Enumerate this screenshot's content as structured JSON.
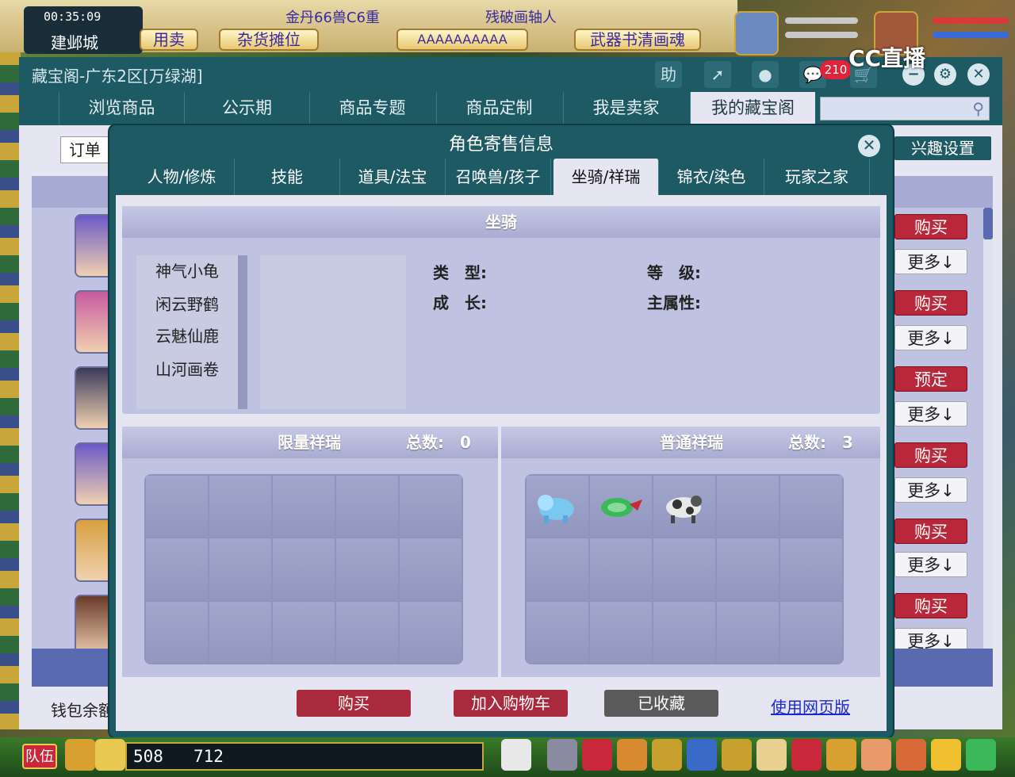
{
  "hud": {
    "clock": "00:35:09",
    "city": "建邺城",
    "buttons": [
      "用卖",
      "杂货摊位",
      "AAAAAAAAAA",
      "武器书清画魂"
    ],
    "top_texts": [
      "金丹66兽C6重",
      "残破画轴人"
    ],
    "team_label": "队伍",
    "coord_x": "508",
    "coord_y": "712",
    "watermark": "CC直播"
  },
  "main_window": {
    "title": "藏宝阁-广东2区[万绿湖]",
    "help_label": "助",
    "notification_count": "210",
    "tabs": [
      "浏览商品",
      "公示期",
      "商品专题",
      "商品定制",
      "我是卖家",
      "我的藏宝阁"
    ],
    "active_tab": 5,
    "order_select": "订单",
    "interest_button": "兴趣设置",
    "wallet_label": "钱包余额",
    "rows": [
      {
        "action": "购买",
        "more": "更多↓",
        "avatar_color": "#6a5ac8"
      },
      {
        "action": "购买",
        "more": "更多↓",
        "avatar_color": "#c85aa0"
      },
      {
        "action": "预定",
        "more": "更多↓",
        "avatar_color": "#3a3a5a"
      },
      {
        "action": "购买",
        "more": "更多↓",
        "avatar_color": "#6a5ac8"
      },
      {
        "action": "购买",
        "more": "更多↓",
        "avatar_color": "#d8a040"
      },
      {
        "action": "购买",
        "more": "更多↓",
        "avatar_color": "#6a3a2a"
      }
    ]
  },
  "dialog": {
    "title": "角色寄售信息",
    "tabs": [
      "人物/修炼",
      "技能",
      "道具/法宝",
      "召唤兽/孩子",
      "坐骑/祥瑞",
      "锦衣/染色",
      "玩家之家"
    ],
    "active_tab": 4,
    "mount_section": {
      "title": "坐骑",
      "mounts": [
        "神气小龟",
        "闲云野鹤",
        "云魅仙鹿",
        "山河画卷"
      ],
      "props": {
        "type_label": "类　型:",
        "level_label": "等　级:",
        "growth_label": "成　长:",
        "main_attr_label": "主属性:"
      }
    },
    "limited_section": {
      "title": "限量祥瑞",
      "total_label": "总数:",
      "total": "0"
    },
    "normal_section": {
      "title": "普通祥瑞",
      "total_label": "总数:",
      "total": "3",
      "items": [
        {
          "icon": "blue-lion-icon",
          "color": "#7ac8f0"
        },
        {
          "icon": "green-turtle-icon",
          "color": "#3ab85a"
        },
        {
          "icon": "spotted-cow-icon",
          "color": "#4a4a4a"
        }
      ]
    },
    "buttons": {
      "buy": "购买",
      "add_cart": "加入购物车",
      "favorited": "已收藏",
      "web_version": "使用网页版"
    }
  }
}
